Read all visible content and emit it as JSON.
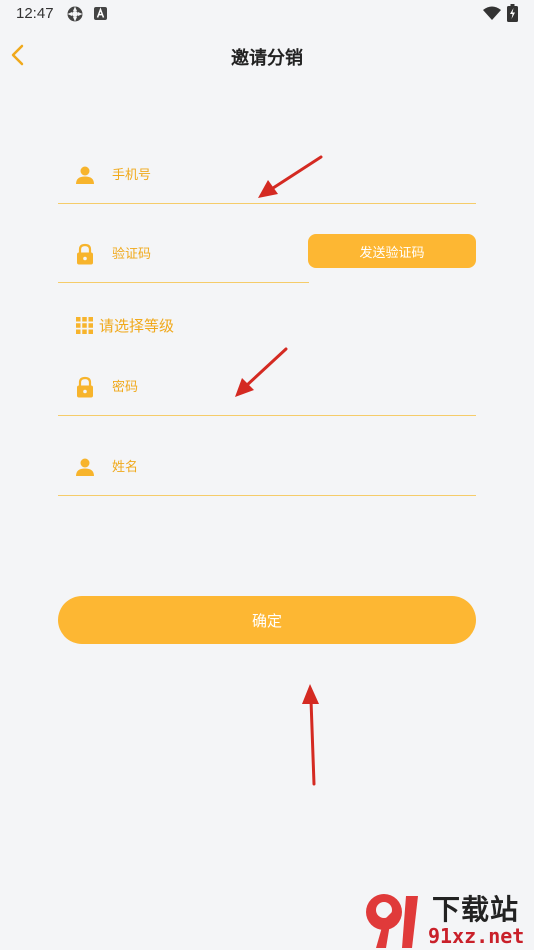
{
  "status_bar": {
    "time": "12:47"
  },
  "header": {
    "title": "邀请分销"
  },
  "form": {
    "phone_placeholder": "手机号",
    "code_placeholder": "验证码",
    "send_code_label": "发送验证码",
    "level_label": "请选择等级",
    "password_placeholder": "密码",
    "name_placeholder": "姓名",
    "confirm_label": "确定"
  },
  "watermark": {
    "top_text": "下载站",
    "bottom_text": "91xz.net"
  },
  "colors": {
    "accent": "#fdb733",
    "accent_text": "#f0a91c",
    "background": "#f4f5f7",
    "arrow": "#d42a22"
  }
}
